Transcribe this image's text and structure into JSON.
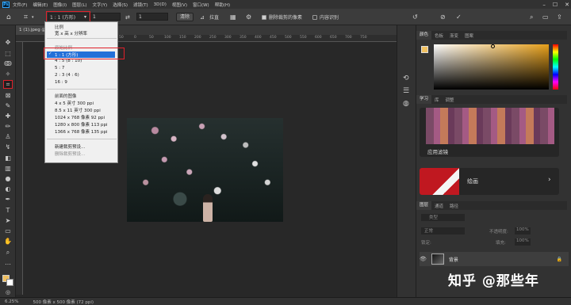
{
  "app": {
    "logo": "Ps"
  },
  "menubar": {
    "items": [
      "文件(F)",
      "编辑(E)",
      "图像(I)",
      "图层(L)",
      "文字(Y)",
      "选择(S)",
      "滤镜(T)",
      "3D(D)",
      "视图(V)",
      "窗口(W)",
      "帮助(H)"
    ]
  },
  "optionsbar": {
    "ratio_label": "1 : 1 (方形)",
    "value1": "1",
    "value2": "1",
    "clear_label": "清除",
    "straighten_label": "拉直",
    "delete_cropped_label": "删除裁剪的像素",
    "content_aware_label": "内容识别"
  },
  "document": {
    "tab_title": "1 (1).jpeg @"
  },
  "ruler": {
    "ticks": [
      "50",
      "0",
      "50",
      "100",
      "150",
      "200",
      "250",
      "300",
      "350",
      "400",
      "450",
      "500",
      "550",
      "600",
      "650",
      "700",
      "750",
      "800",
      "850",
      "900",
      "950"
    ]
  },
  "dropdown": {
    "section_ratio": "比例",
    "option_wh": "宽 x 高 x 分辨率",
    "section_original": "原始比例",
    "selected": "1 : 1 (方形)",
    "ratios": [
      "4 : 5 (8 : 10)",
      "5 : 7",
      "2 : 3 (4 : 6)",
      "16 : 9"
    ],
    "section_front": "前面的图像",
    "sizes": [
      "4 x 5 英寸 300 ppi",
      "8.5 x 11 英寸 300 ppi",
      "1024 x 768 像素 92 ppi",
      "1280 x 800 像素 113 ppi",
      "1366 x 768 像素 135 ppi"
    ],
    "new_preset": "新建裁剪预设...",
    "delete_preset": "删除裁剪预设..."
  },
  "panels": {
    "color_tabs": [
      "颜色",
      "色板",
      "渐变",
      "图案"
    ],
    "learn_tabs": [
      "学习",
      "库",
      "调整"
    ],
    "learn_card1": "应用滤镜",
    "learn_card2": "绘画",
    "layers_tabs": [
      "图层",
      "通道",
      "路径"
    ],
    "layers_kind": "类型",
    "blend_mode": "正常",
    "opacity_label": "不透明度:",
    "opacity_value": "100%",
    "lock_label": "锁定:",
    "fill_label": "填充:",
    "fill_value": "100%",
    "layer_name": "背景"
  },
  "watermark": "知乎 @那些年",
  "status": {
    "zoom": "6.25%",
    "doc_size": "500 像素 x 500 像素 (72 ppi)"
  },
  "colors": {
    "accent_red": "#e0202a",
    "highlight_blue": "#2470d8",
    "fg_color": "#f0c060"
  }
}
